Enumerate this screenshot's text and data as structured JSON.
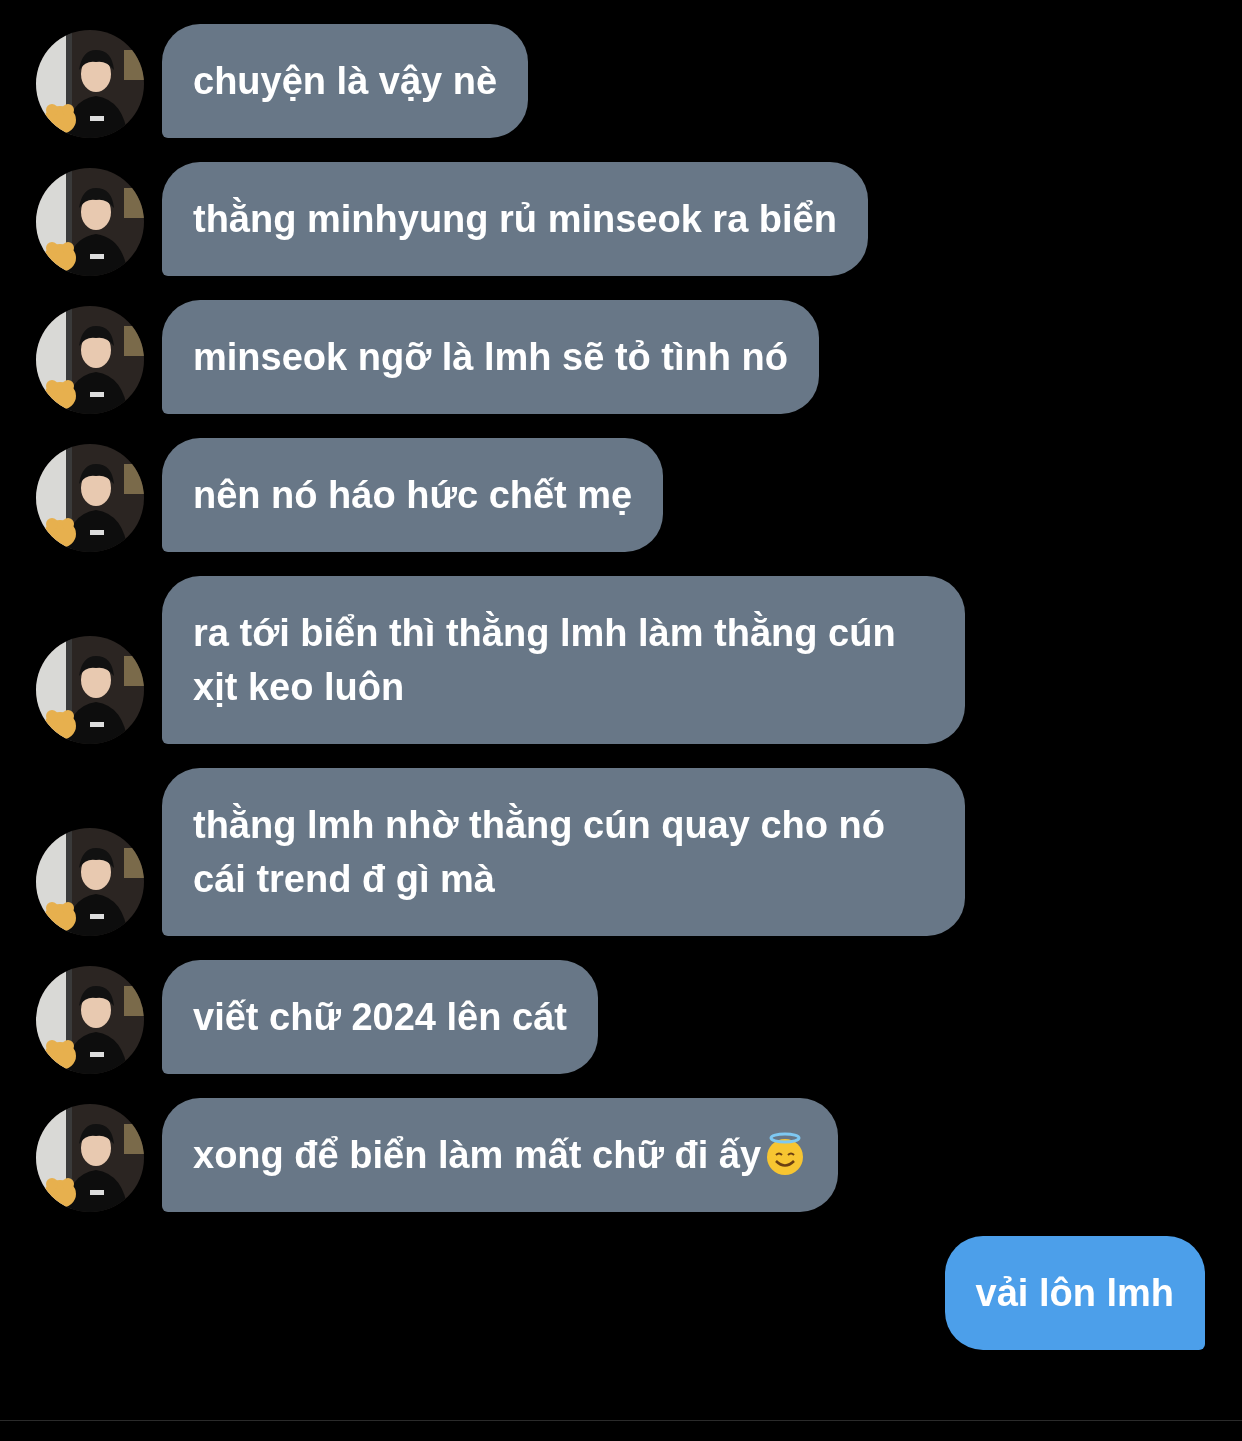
{
  "messages": [
    {
      "kind": "text",
      "incoming": true,
      "text": "chuyện là vậy nè"
    },
    {
      "kind": "text",
      "incoming": true,
      "text": "thằng minhyung rủ minseok ra biển"
    },
    {
      "kind": "text",
      "incoming": true,
      "text": "minseok ngỡ là lmh sẽ tỏ tình nó"
    },
    {
      "kind": "text",
      "incoming": true,
      "text": "nên nó háo hức chết mẹ"
    },
    {
      "kind": "text",
      "incoming": true,
      "text": "ra tới biển thì thằng lmh làm thằng cún xịt keo luôn"
    },
    {
      "kind": "text",
      "incoming": true,
      "text": "thằng lmh nhờ thằng cún quay cho nó cái trend đ gì mà"
    },
    {
      "kind": "text",
      "incoming": true,
      "text": "viết chữ 2024 lên cát"
    },
    {
      "kind": "emoji_end",
      "incoming": true,
      "text": "xong để biển làm mất chữ đi ấy"
    },
    {
      "kind": "text",
      "incoming": false,
      "text": "vải lôn lmh"
    }
  ]
}
